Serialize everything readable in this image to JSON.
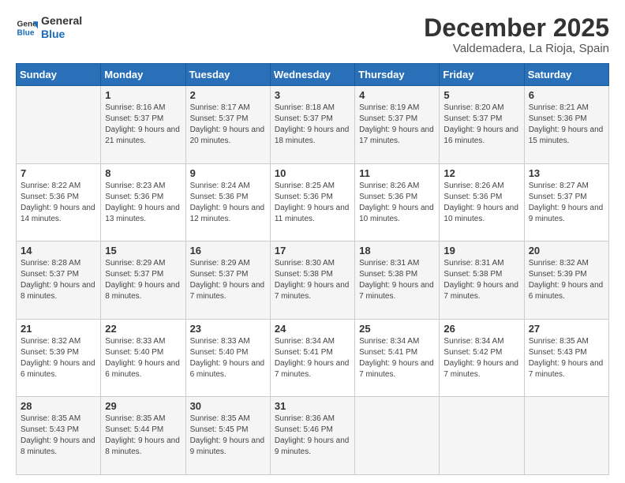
{
  "logo": {
    "line1": "General",
    "line2": "Blue"
  },
  "header": {
    "month": "December 2025",
    "location": "Valdemadera, La Rioja, Spain"
  },
  "days_of_week": [
    "Sunday",
    "Monday",
    "Tuesday",
    "Wednesday",
    "Thursday",
    "Friday",
    "Saturday"
  ],
  "weeks": [
    [
      {
        "day": "",
        "sunrise": "",
        "sunset": "",
        "daylight": ""
      },
      {
        "day": "1",
        "sunrise": "Sunrise: 8:16 AM",
        "sunset": "Sunset: 5:37 PM",
        "daylight": "Daylight: 9 hours and 21 minutes."
      },
      {
        "day": "2",
        "sunrise": "Sunrise: 8:17 AM",
        "sunset": "Sunset: 5:37 PM",
        "daylight": "Daylight: 9 hours and 20 minutes."
      },
      {
        "day": "3",
        "sunrise": "Sunrise: 8:18 AM",
        "sunset": "Sunset: 5:37 PM",
        "daylight": "Daylight: 9 hours and 18 minutes."
      },
      {
        "day": "4",
        "sunrise": "Sunrise: 8:19 AM",
        "sunset": "Sunset: 5:37 PM",
        "daylight": "Daylight: 9 hours and 17 minutes."
      },
      {
        "day": "5",
        "sunrise": "Sunrise: 8:20 AM",
        "sunset": "Sunset: 5:37 PM",
        "daylight": "Daylight: 9 hours and 16 minutes."
      },
      {
        "day": "6",
        "sunrise": "Sunrise: 8:21 AM",
        "sunset": "Sunset: 5:36 PM",
        "daylight": "Daylight: 9 hours and 15 minutes."
      }
    ],
    [
      {
        "day": "7",
        "sunrise": "Sunrise: 8:22 AM",
        "sunset": "Sunset: 5:36 PM",
        "daylight": "Daylight: 9 hours and 14 minutes."
      },
      {
        "day": "8",
        "sunrise": "Sunrise: 8:23 AM",
        "sunset": "Sunset: 5:36 PM",
        "daylight": "Daylight: 9 hours and 13 minutes."
      },
      {
        "day": "9",
        "sunrise": "Sunrise: 8:24 AM",
        "sunset": "Sunset: 5:36 PM",
        "daylight": "Daylight: 9 hours and 12 minutes."
      },
      {
        "day": "10",
        "sunrise": "Sunrise: 8:25 AM",
        "sunset": "Sunset: 5:36 PM",
        "daylight": "Daylight: 9 hours and 11 minutes."
      },
      {
        "day": "11",
        "sunrise": "Sunrise: 8:26 AM",
        "sunset": "Sunset: 5:36 PM",
        "daylight": "Daylight: 9 hours and 10 minutes."
      },
      {
        "day": "12",
        "sunrise": "Sunrise: 8:26 AM",
        "sunset": "Sunset: 5:36 PM",
        "daylight": "Daylight: 9 hours and 10 minutes."
      },
      {
        "day": "13",
        "sunrise": "Sunrise: 8:27 AM",
        "sunset": "Sunset: 5:37 PM",
        "daylight": "Daylight: 9 hours and 9 minutes."
      }
    ],
    [
      {
        "day": "14",
        "sunrise": "Sunrise: 8:28 AM",
        "sunset": "Sunset: 5:37 PM",
        "daylight": "Daylight: 9 hours and 8 minutes."
      },
      {
        "day": "15",
        "sunrise": "Sunrise: 8:29 AM",
        "sunset": "Sunset: 5:37 PM",
        "daylight": "Daylight: 9 hours and 8 minutes."
      },
      {
        "day": "16",
        "sunrise": "Sunrise: 8:29 AM",
        "sunset": "Sunset: 5:37 PM",
        "daylight": "Daylight: 9 hours and 7 minutes."
      },
      {
        "day": "17",
        "sunrise": "Sunrise: 8:30 AM",
        "sunset": "Sunset: 5:38 PM",
        "daylight": "Daylight: 9 hours and 7 minutes."
      },
      {
        "day": "18",
        "sunrise": "Sunrise: 8:31 AM",
        "sunset": "Sunset: 5:38 PM",
        "daylight": "Daylight: 9 hours and 7 minutes."
      },
      {
        "day": "19",
        "sunrise": "Sunrise: 8:31 AM",
        "sunset": "Sunset: 5:38 PM",
        "daylight": "Daylight: 9 hours and 7 minutes."
      },
      {
        "day": "20",
        "sunrise": "Sunrise: 8:32 AM",
        "sunset": "Sunset: 5:39 PM",
        "daylight": "Daylight: 9 hours and 6 minutes."
      }
    ],
    [
      {
        "day": "21",
        "sunrise": "Sunrise: 8:32 AM",
        "sunset": "Sunset: 5:39 PM",
        "daylight": "Daylight: 9 hours and 6 minutes."
      },
      {
        "day": "22",
        "sunrise": "Sunrise: 8:33 AM",
        "sunset": "Sunset: 5:40 PM",
        "daylight": "Daylight: 9 hours and 6 minutes."
      },
      {
        "day": "23",
        "sunrise": "Sunrise: 8:33 AM",
        "sunset": "Sunset: 5:40 PM",
        "daylight": "Daylight: 9 hours and 6 minutes."
      },
      {
        "day": "24",
        "sunrise": "Sunrise: 8:34 AM",
        "sunset": "Sunset: 5:41 PM",
        "daylight": "Daylight: 9 hours and 7 minutes."
      },
      {
        "day": "25",
        "sunrise": "Sunrise: 8:34 AM",
        "sunset": "Sunset: 5:41 PM",
        "daylight": "Daylight: 9 hours and 7 minutes."
      },
      {
        "day": "26",
        "sunrise": "Sunrise: 8:34 AM",
        "sunset": "Sunset: 5:42 PM",
        "daylight": "Daylight: 9 hours and 7 minutes."
      },
      {
        "day": "27",
        "sunrise": "Sunrise: 8:35 AM",
        "sunset": "Sunset: 5:43 PM",
        "daylight": "Daylight: 9 hours and 7 minutes."
      }
    ],
    [
      {
        "day": "28",
        "sunrise": "Sunrise: 8:35 AM",
        "sunset": "Sunset: 5:43 PM",
        "daylight": "Daylight: 9 hours and 8 minutes."
      },
      {
        "day": "29",
        "sunrise": "Sunrise: 8:35 AM",
        "sunset": "Sunset: 5:44 PM",
        "daylight": "Daylight: 9 hours and 8 minutes."
      },
      {
        "day": "30",
        "sunrise": "Sunrise: 8:35 AM",
        "sunset": "Sunset: 5:45 PM",
        "daylight": "Daylight: 9 hours and 9 minutes."
      },
      {
        "day": "31",
        "sunrise": "Sunrise: 8:36 AM",
        "sunset": "Sunset: 5:46 PM",
        "daylight": "Daylight: 9 hours and 9 minutes."
      },
      {
        "day": "",
        "sunrise": "",
        "sunset": "",
        "daylight": ""
      },
      {
        "day": "",
        "sunrise": "",
        "sunset": "",
        "daylight": ""
      },
      {
        "day": "",
        "sunrise": "",
        "sunset": "",
        "daylight": ""
      }
    ]
  ]
}
